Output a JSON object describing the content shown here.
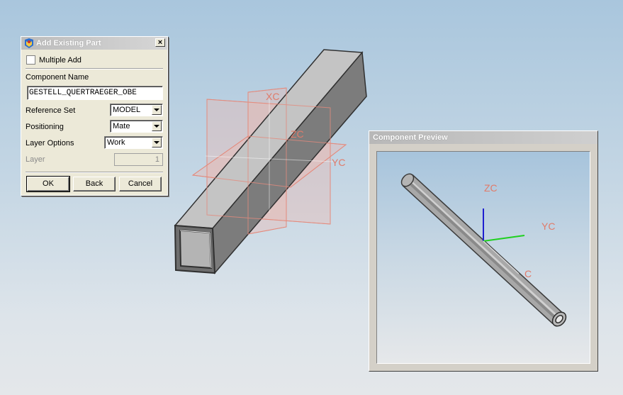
{
  "dialog": {
    "title": "Add Existing Part",
    "close_label": "×",
    "multiple_add_label": "Multiple Add",
    "multiple_add_checked": false,
    "component_name_label": "Component Name",
    "component_name_value": "GESTELL_QUERTRAEGER_OBE",
    "reference_set_label": "Reference Set",
    "reference_set_value": "MODEL",
    "positioning_label": "Positioning",
    "positioning_value": "Mate",
    "layer_options_label": "Layer Options",
    "layer_options_value": "Work",
    "layer_label": "Layer",
    "layer_value": "1",
    "ok_label": "OK",
    "back_label": "Back",
    "cancel_label": "Cancel"
  },
  "viewport": {
    "axis_labels": {
      "x": "XC",
      "y": "YC",
      "z": "ZC"
    },
    "plane_color": "#e48a7c",
    "beam_color": "#a8a8a8"
  },
  "preview": {
    "title": "Component Preview",
    "axis_labels": {
      "z": "ZC",
      "y": "YC",
      "x": "C"
    },
    "axis_colors": {
      "z": "#1f1fd0",
      "y": "#1fd01f",
      "x": "#d8d8d8"
    }
  }
}
